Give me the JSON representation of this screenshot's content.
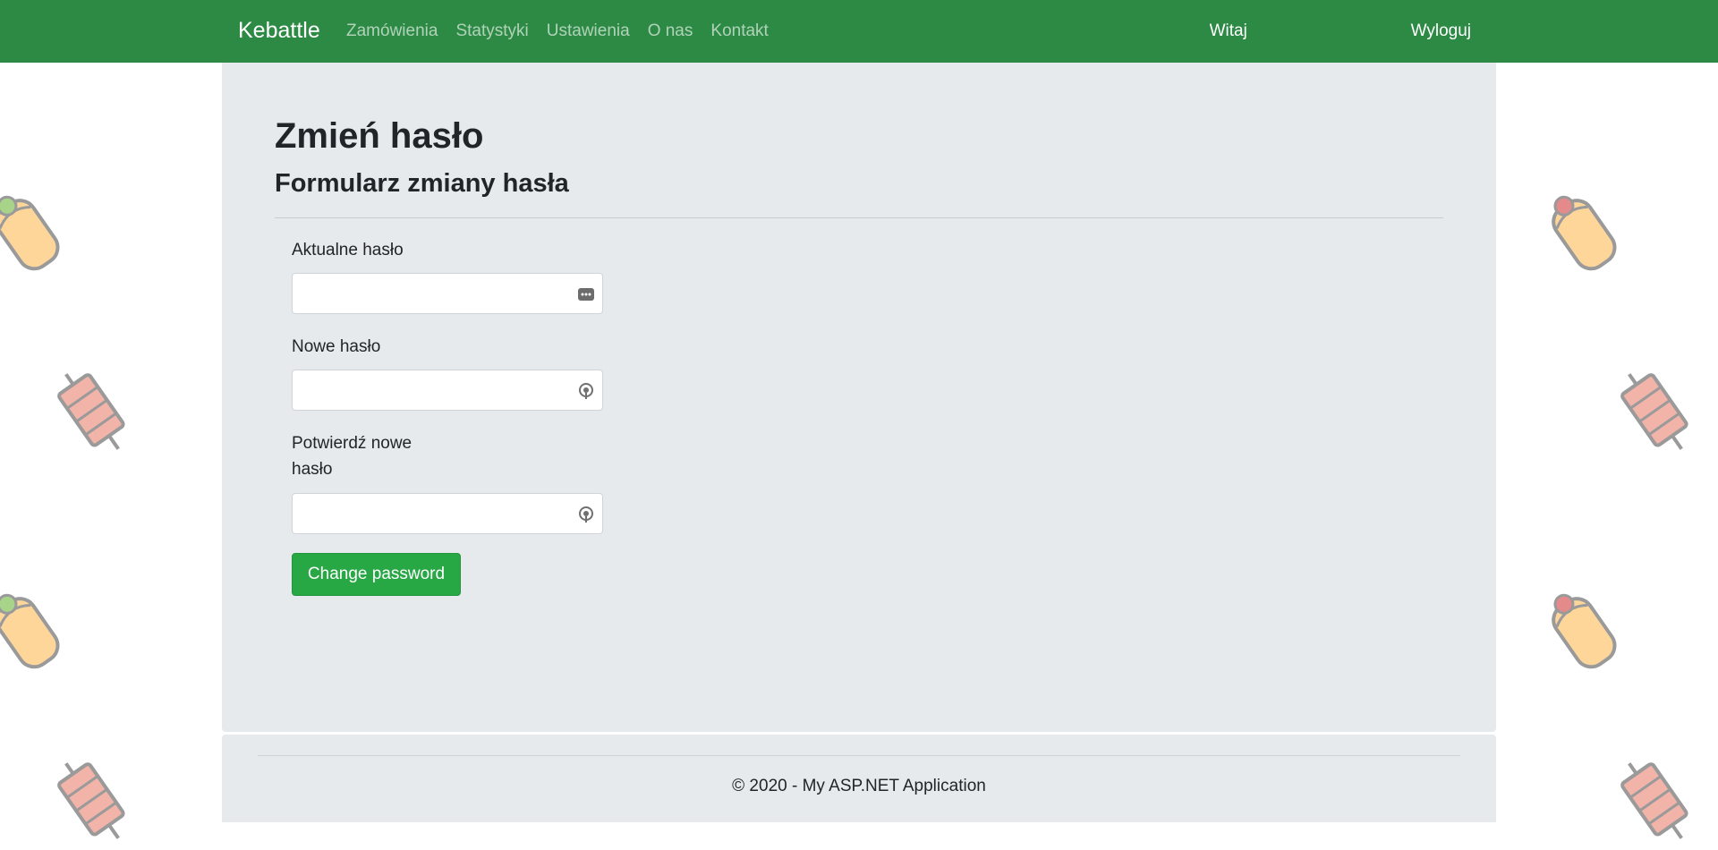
{
  "navbar": {
    "brand": "Kebattle",
    "links": [
      "Zamówienia",
      "Statystyki",
      "Ustawienia",
      "O nas",
      "Kontakt"
    ],
    "greeting": "Witaj",
    "logout": "Wyloguj"
  },
  "page": {
    "title": "Zmień hasło",
    "subtitle": "Formularz zmiany hasła"
  },
  "form": {
    "current_label": "Aktualne hasło",
    "current_value": "",
    "new_label": "Nowe hasło",
    "new_value": "",
    "confirm_label": "Potwierdź nowe hasło",
    "confirm_value": "",
    "submit_label": "Change password"
  },
  "footer": {
    "text": "© 2020 - My ASP.NET Application"
  },
  "colors": {
    "navbar": "#2d8a45",
    "panel": "#e7eaed",
    "button": "#28a745"
  },
  "icons": {
    "current_field": "password-manager-icon",
    "new_field": "password-key-icon",
    "confirm_field": "password-key-icon",
    "background": "kebab-pattern"
  }
}
